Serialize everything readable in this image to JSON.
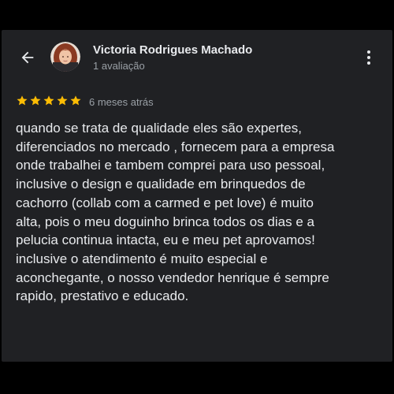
{
  "colors": {
    "background": "#000000",
    "panel": "#202124",
    "text_primary": "#e8eaed",
    "text_secondary": "#9aa0a6",
    "star": "#fbbc04"
  },
  "header": {
    "back_icon": "arrow-left-icon",
    "reviewer_name": "Victoria Rodrigues Machado",
    "review_count": "1 avaliação",
    "more_icon": "more-vert-icon"
  },
  "review": {
    "rating": 5,
    "max_rating": 5,
    "date": "6 meses atrás",
    "lines": [
      "quando se trata de qualidade eles são expertes,",
      "diferenciados no mercado , fornecem para a empresa",
      "onde trabalhei e tambem comprei para uso pessoal,",
      "inclusive o design e qualidade em brinquedos de",
      "cachorro (collab com a carmed e pet love) é muito",
      "alta, pois o meu doguinho brinca todos os dias e a",
      "pelucia continua intacta, eu e meu pet aprovamos!",
      "inclusive o atendimento é muito especial e",
      "aconchegante, o nosso vendedor henrique é sempre",
      "rapido, prestativo e educado."
    ]
  }
}
